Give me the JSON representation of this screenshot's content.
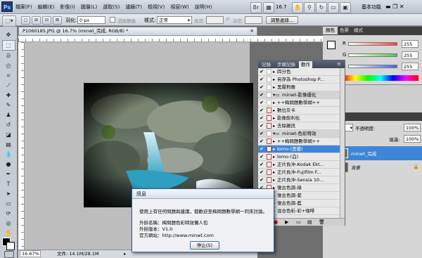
{
  "menubar": {
    "logo": "Ps",
    "items": [
      "檔案(F)",
      "編輯(E)",
      "影像(I)",
      "圖層(L)",
      "選取(S)",
      "濾鏡(T)",
      "檢視(V)",
      "視窗(W)",
      "說明(H)"
    ],
    "zoom": "16.7",
    "workspace": "基本功能"
  },
  "optionsbar": {
    "feather_label": "羽化:",
    "feather_value": "0 px",
    "antialias_label": "消除鋸齒",
    "style_label": "樣式:",
    "style_value": "正常",
    "width_label": "寬度:",
    "height_label": "高度:",
    "refine_label": "調整邊緣..."
  },
  "document": {
    "tab_title": "P1060185.JPG @ 16.7% (minwt_完成, RGB/8) *",
    "zoom_status": "16.67%",
    "file_status": "文件: 14.1M/28.1M"
  },
  "actions_panel": {
    "tabs": [
      "記錄",
      "步驟記錄",
      "動作"
    ],
    "rows": [
      {
        "label": "四分色",
        "checked": true,
        "dialog": false,
        "type": "action"
      },
      {
        "label": "另存為 Photoshop P...",
        "checked": true,
        "dialog": false,
        "type": "action"
      },
      {
        "label": "黑霧對應",
        "checked": true,
        "dialog": false,
        "type": "action"
      },
      {
        "label": "minwt-影像優化",
        "checked": true,
        "dialog": false,
        "type": "set"
      },
      {
        "label": "++梅問題數學網++",
        "checked": true,
        "dialog": false,
        "type": "action"
      },
      {
        "label": "數位灰卡",
        "checked": true,
        "dialog": true,
        "type": "action"
      },
      {
        "label": "影像銳利化",
        "checked": true,
        "dialog": true,
        "type": "action"
      },
      {
        "label": "去除雜訊",
        "checked": true,
        "dialog": true,
        "type": "action"
      },
      {
        "label": "minwt-色彩特效",
        "checked": true,
        "dialog": false,
        "type": "set"
      },
      {
        "label": "++梅問題數學網++",
        "checked": true,
        "dialog": true,
        "type": "action"
      },
      {
        "label": "lomo-(黑暈)",
        "checked": true,
        "dialog": true,
        "type": "action",
        "selected": true
      },
      {
        "label": "lomo-(白)",
        "checked": true,
        "dialog": true,
        "type": "action"
      },
      {
        "label": "正片負沖-Kodak Ekt...",
        "checked": true,
        "dialog": true,
        "type": "action"
      },
      {
        "label": "正片負沖-Fujifilm F...",
        "checked": true,
        "dialog": true,
        "type": "action"
      },
      {
        "label": "正片負沖-Sensia 10...",
        "checked": true,
        "dialog": true,
        "type": "action"
      },
      {
        "label": "復古色調-綠",
        "checked": true,
        "dialog": true,
        "type": "action"
      },
      {
        "label": "復古色調-紫",
        "checked": true,
        "dialog": true,
        "type": "action"
      },
      {
        "label": "復古色調-藍",
        "checked": true,
        "dialog": true,
        "type": "action"
      },
      {
        "label": "混合色彩-彩+咖啡",
        "checked": true,
        "dialog": true,
        "type": "action"
      }
    ]
  },
  "color_panel": {
    "tabs": [
      "顏色",
      "色票",
      "樣式"
    ],
    "channels": [
      {
        "label": "R",
        "value": "255",
        "color": "#ff4040"
      },
      {
        "label": "G",
        "value": "255",
        "color": "#40d040"
      },
      {
        "label": "B",
        "value": "255",
        "color": "#4060ff"
      }
    ]
  },
  "layers_panel": {
    "tab": "圖層",
    "opacity_label": "不透明度:",
    "opacity_value": "100%",
    "fill_label": "填滿:",
    "fill_value": "100%",
    "layers": [
      {
        "name": "minwt_完成",
        "selected": true
      },
      {
        "name": "背景",
        "selected": false
      }
    ]
  },
  "dialog": {
    "title": "訊息",
    "message": "使用上有任何問題與建議，都歡迎至梅問題數學網一同來討論。",
    "plugin_name": "外掛名稱：梅問題色彩特效懶人包",
    "plugin_version": "外掛版本：V1.0",
    "website": "官方網站：http://www.minwt.com",
    "stop_button": "停止(S)"
  }
}
